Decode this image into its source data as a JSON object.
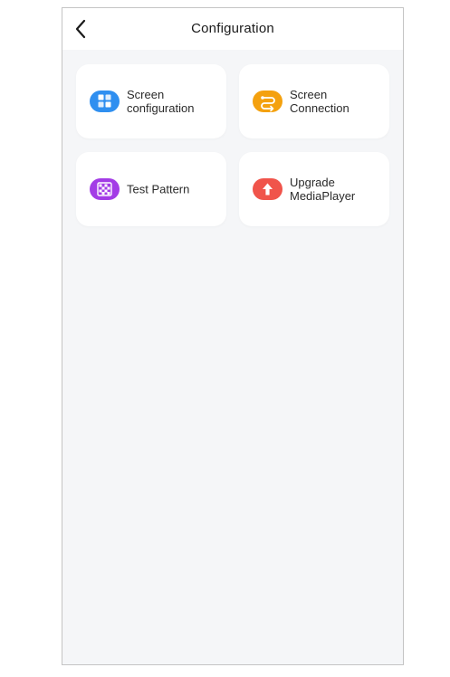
{
  "header": {
    "title": "Configuration",
    "back_icon": "chevron-left-icon"
  },
  "cards": [
    {
      "label": "Screen\nconfiguration",
      "icon": "screen-config-icon",
      "color": "#2f8ff0"
    },
    {
      "label": "Screen\nConnection",
      "icon": "screen-connection-icon",
      "color": "#f4a10f"
    },
    {
      "label": "Test Pattern",
      "icon": "test-pattern-icon",
      "color": "#a33ce6"
    },
    {
      "label": "Upgrade\nMediaPlayer",
      "icon": "upgrade-icon",
      "color": "#f0544b"
    }
  ]
}
